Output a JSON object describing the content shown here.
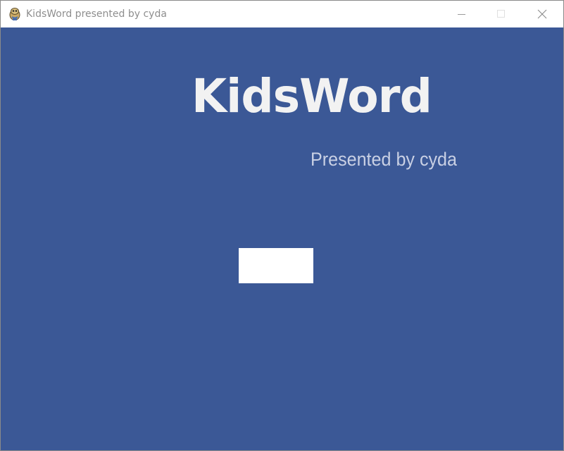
{
  "window": {
    "title": "KidsWord presented by cyda",
    "icon": "pygame-snake-icon"
  },
  "controls": {
    "minimize_icon": "minimize-icon",
    "maximize_icon": "maximize-icon",
    "close_icon": "close-icon"
  },
  "splash": {
    "title": "KidsWord",
    "subtitle": "Presented by cyda",
    "background_color": "#3b5896",
    "start_button_label": ""
  }
}
